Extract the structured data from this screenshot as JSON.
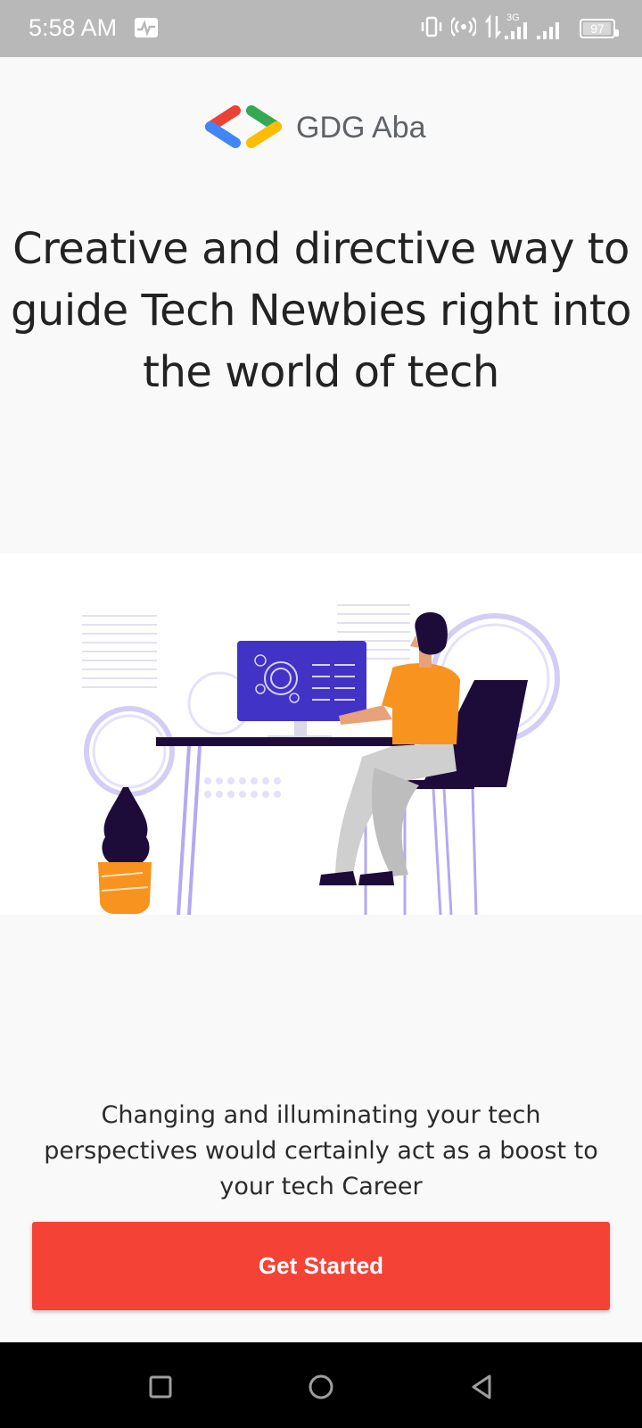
{
  "status_bar": {
    "time": "5:58 AM",
    "network": "3G",
    "battery": "97",
    "battery_level": 0.97,
    "icons": [
      "activity-icon",
      "vibrate-icon",
      "hotspot-icon",
      "data-transfer-icon",
      "signal-icon",
      "battery-icon"
    ]
  },
  "brand": {
    "name": "GDG Aba",
    "logo_colors": [
      "#ea4335",
      "#4285f4",
      "#34a853",
      "#fbbc04"
    ]
  },
  "hero": {
    "headline": "Creative and directive way to guide Tech Newbies right into the world of tech",
    "illustration": "person-at-desk-illustration"
  },
  "tagline": "Changing and illuminating your tech perspectives would certainly act as a boost to your tech Career",
  "cta": {
    "label": "Get Started",
    "color": "#f44336"
  },
  "nav_bar": {
    "icons": [
      "recents-icon",
      "home-icon",
      "back-icon"
    ]
  }
}
